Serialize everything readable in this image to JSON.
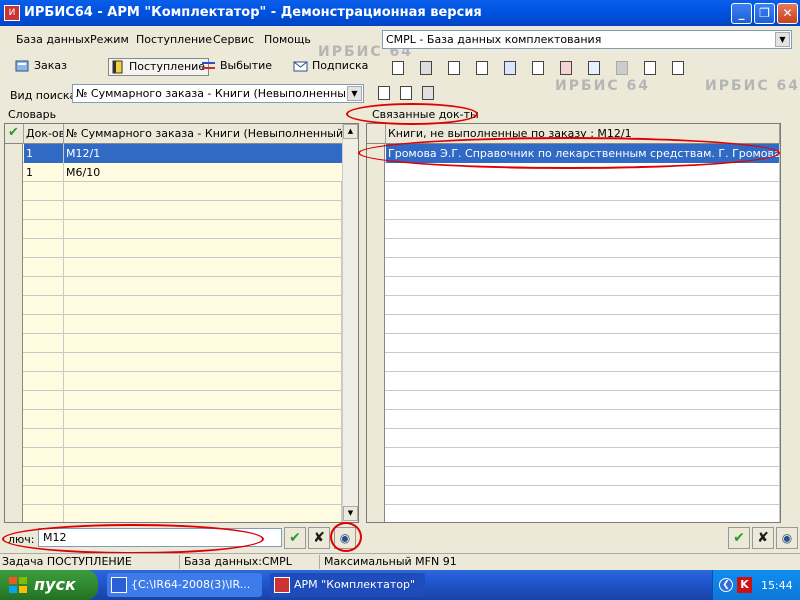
{
  "window": {
    "title": "ИРБИС64 - АРМ \"Комплектатор\" - Демонстрационная версия",
    "min": "_",
    "max": "❐",
    "close": "✕"
  },
  "menu": [
    "База данных",
    "Режим",
    "Поступление",
    "Сервис",
    "Помощь"
  ],
  "watermark": "ИРБИС 64",
  "database": {
    "selected": "CMPL - База данных комплектования"
  },
  "toolbar": {
    "order": "Заказ",
    "receipt": "Поступление",
    "disposal": "Выбытие",
    "subscription": "Подписка"
  },
  "search": {
    "label": "Вид поиска",
    "selected": "№ Суммарного заказа - Книги (Невыполненный заказ)"
  },
  "dictionary": {
    "label": "Словарь",
    "columns": [
      "Док-ов",
      "№ Суммарного заказа - Книги (Невыполненный заказ)"
    ],
    "rows": [
      {
        "count": "1",
        "term": "M12/1",
        "selected": true
      },
      {
        "count": "1",
        "term": "M6/10",
        "selected": false
      }
    ]
  },
  "linked": {
    "label": "Связанные док-ты",
    "header": "Книги, не выполненные по заказу                    : M12/1",
    "rows": [
      {
        "text": "Громова Э.Г. Справочник по лекарственным средствам. Г. Громова",
        "selected": true
      }
    ]
  },
  "key": {
    "label": "люч:",
    "value": "M12"
  },
  "status": {
    "task": "Задача ПОСТУПЛЕНИЕ",
    "db": "База данных:CMPL",
    "mfn": "Максимальный MFN 91"
  },
  "taskbar": {
    "start": "пуск",
    "tasks": [
      "{C:\\IR64-2008(3)\\IR...",
      "АРМ \"Комплектатор\""
    ],
    "clock": "15:44"
  },
  "colors": {
    "title": "#0054e3",
    "selection": "#316ac5",
    "dict_bg": "#fffbe0",
    "annotation": "#e00000"
  }
}
